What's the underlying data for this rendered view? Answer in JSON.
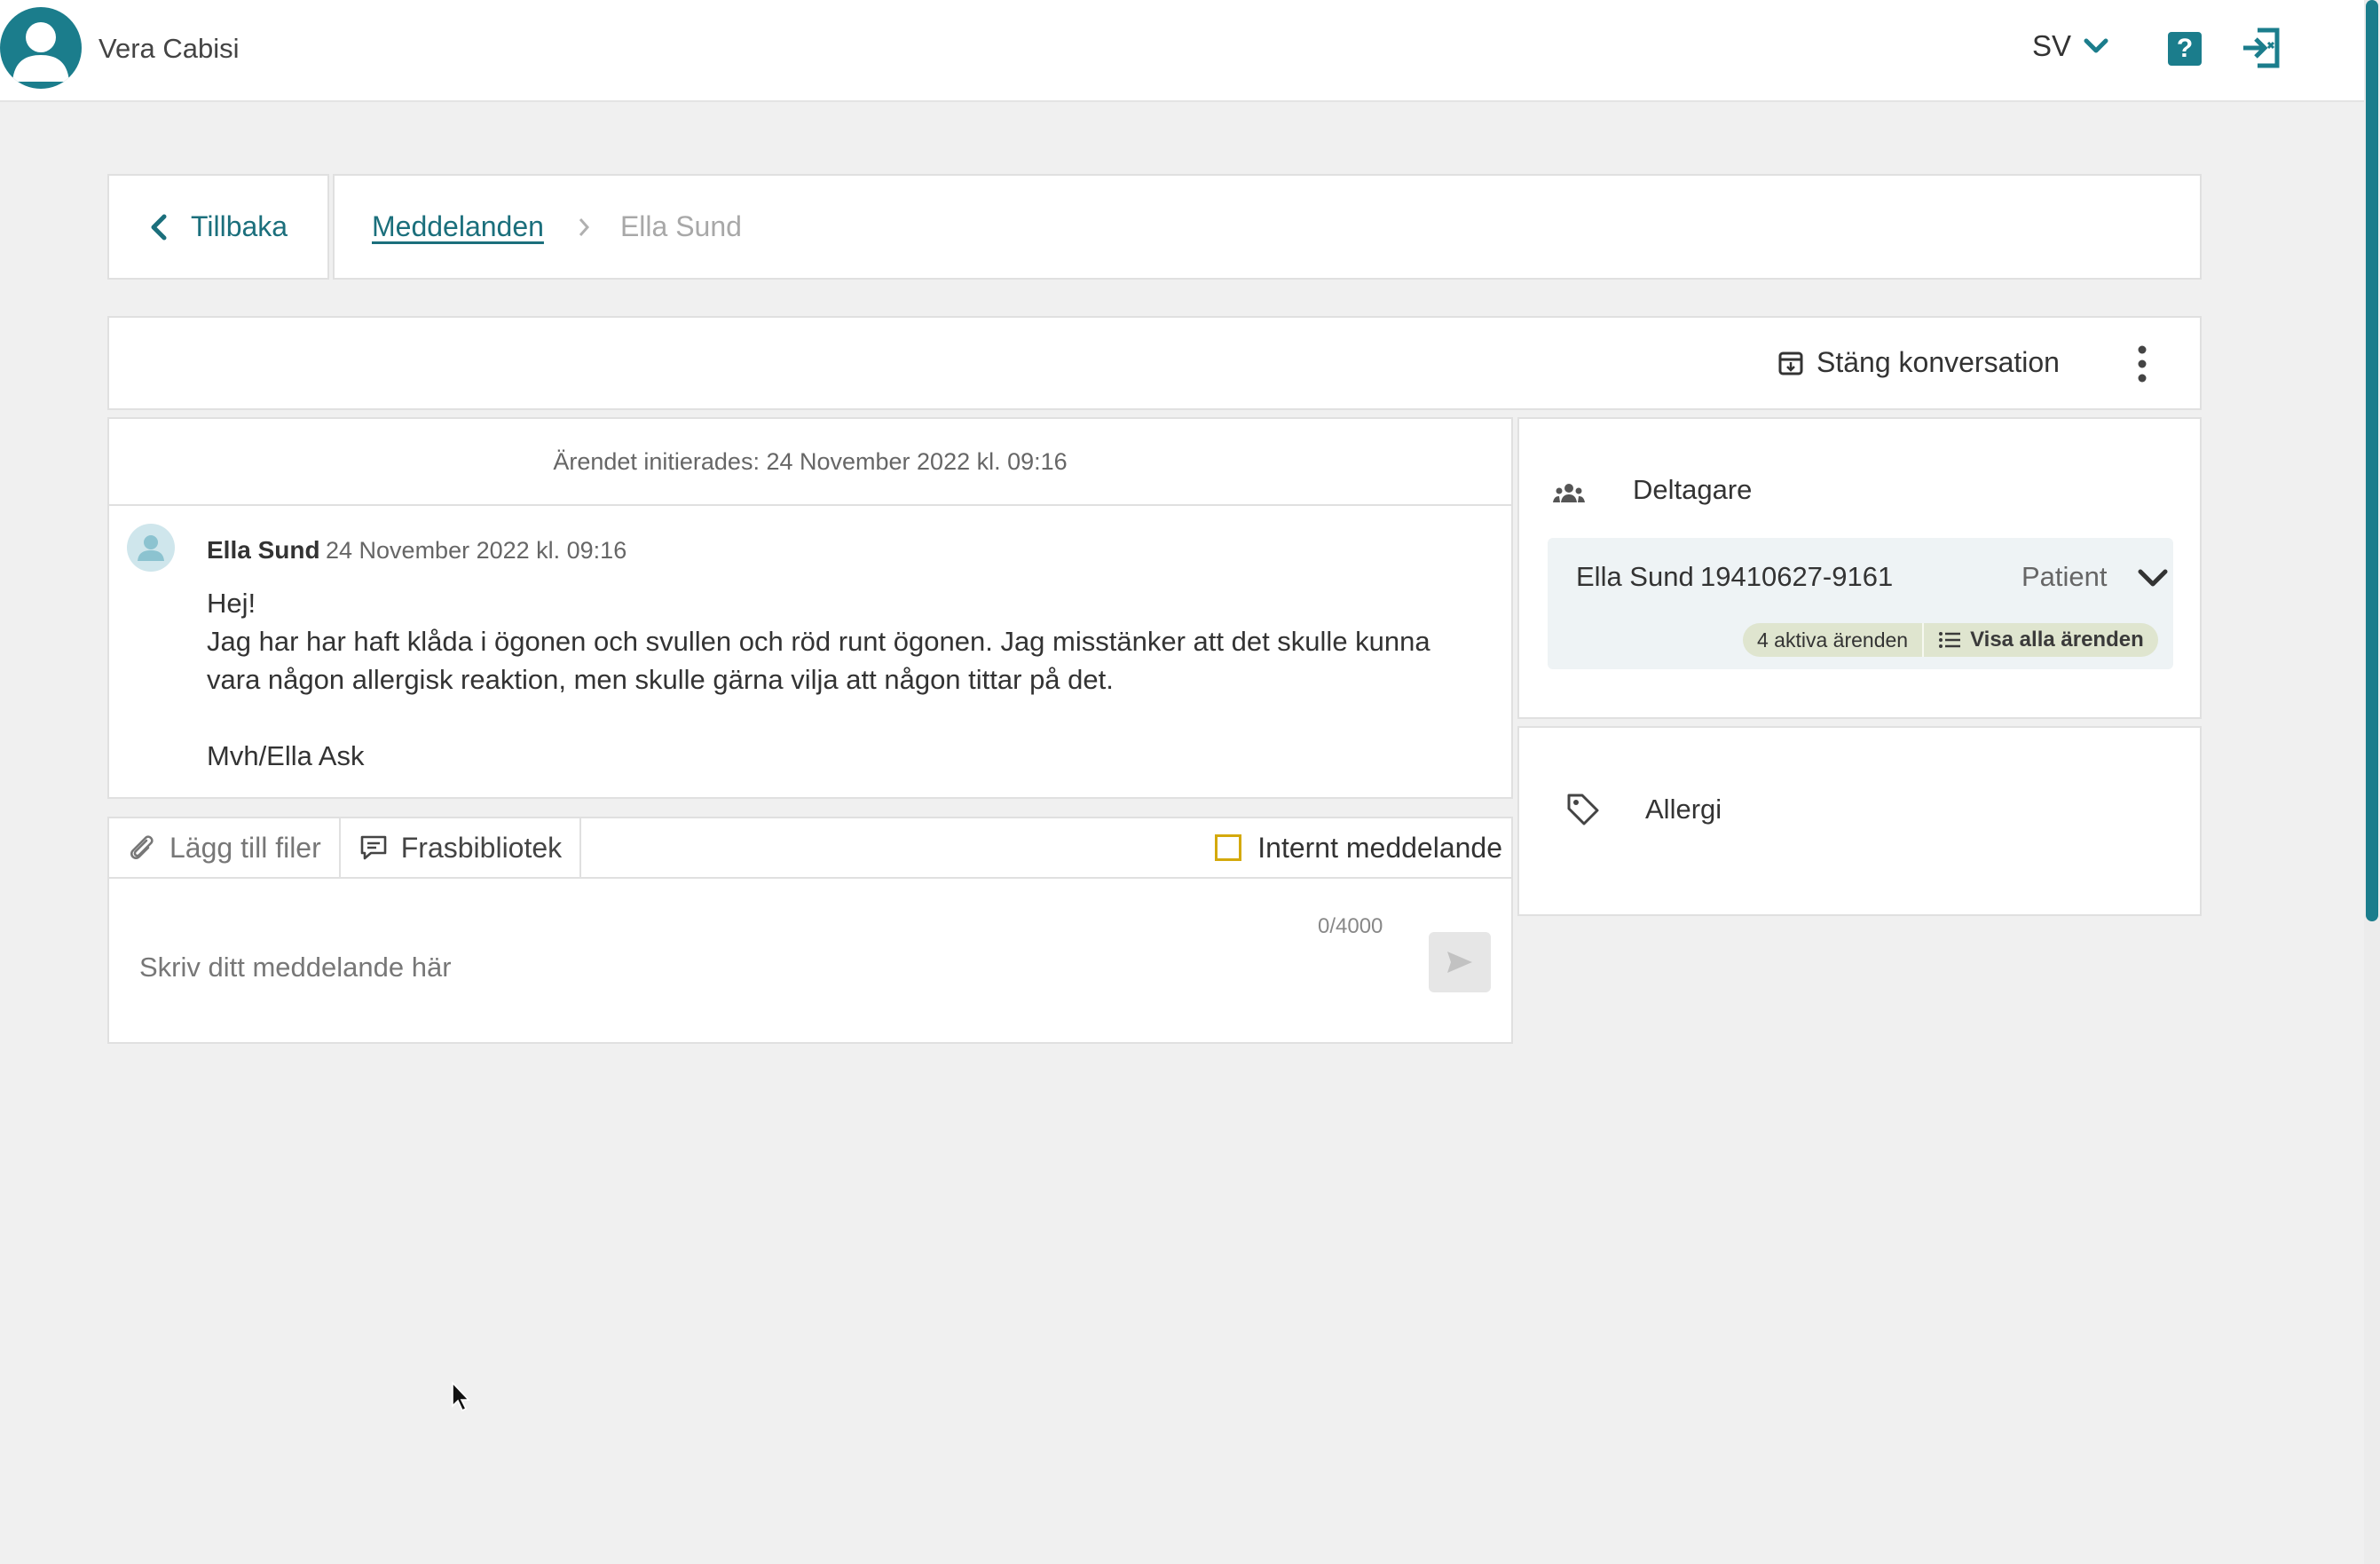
{
  "header": {
    "user_name": "Vera Cabisi",
    "language": "SV",
    "help_label": "?"
  },
  "nav": {
    "back_label": "Tillbaka",
    "breadcrumb_link": "Meddelanden",
    "breadcrumb_current": "Ella Sund"
  },
  "actions": {
    "close_conversation": "Stäng konversation"
  },
  "thread": {
    "initiated_text": "Ärendet initierades: 24 November 2022 kl. 09:16",
    "message": {
      "author": "Ella Sund",
      "timestamp": "24 November 2022 kl. 09:16",
      "body": "Hej!\nJag har har haft klåda i ögonen och svullen och röd runt ögonen. Jag misstänker att det skulle kunna vara någon allergisk reaktion, men skulle gärna vilja att någon tittar på det.\n\nMvh/Ella Ask"
    }
  },
  "composer": {
    "attach_label": "Lägg till filer",
    "phrase_library_label": "Frasbibliotek",
    "internal_label": "Internt meddelande",
    "internal_checked": false,
    "counter": "0/4000",
    "placeholder": "Skriv ditt meddelande här",
    "value": ""
  },
  "participants": {
    "title": "Deltagare",
    "items": [
      {
        "name": "Ella Sund",
        "personal_number": "19410627-9161",
        "role": "Patient",
        "active_cases": "4 aktiva ärenden",
        "show_all_label": "Visa alla ärenden"
      }
    ]
  },
  "tags": {
    "items": [
      "Allergi"
    ]
  },
  "colors": {
    "brand_teal": "#1b7d8c",
    "link_teal": "#1b6f7c",
    "checkbox_yellow": "#d4a90c",
    "badge_green": "#dfe5cf",
    "background": "#f0f0f0"
  }
}
